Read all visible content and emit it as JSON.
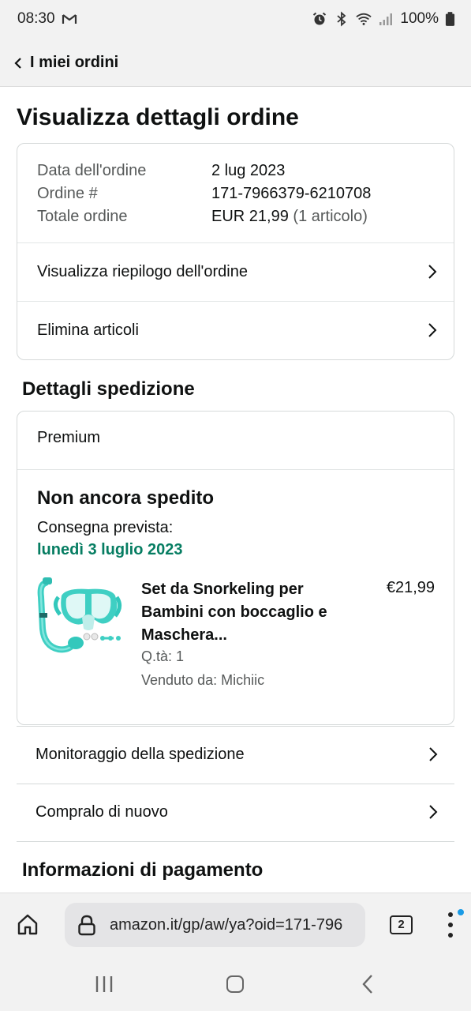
{
  "status_bar": {
    "time": "08:30",
    "battery": "100%",
    "icons": [
      "gmail-icon",
      "alarm-icon",
      "bluetooth-icon",
      "wifi-icon",
      "signal-icon",
      "battery-icon"
    ]
  },
  "header": {
    "back_label": "I miei ordini"
  },
  "page": {
    "title": "Visualizza dettagli ordine"
  },
  "order_summary": {
    "date_label": "Data dell'ordine",
    "date_value": "2 lug 2023",
    "number_label": "Ordine #",
    "number_value": "171-7966379-6210708",
    "total_label": "Totale ordine",
    "total_value": "EUR 21,99",
    "total_items": "(1 articolo)",
    "links": [
      {
        "label": "Visualizza riepilogo dell'ordine"
      },
      {
        "label": "Elimina articoli"
      }
    ]
  },
  "shipping": {
    "section_title": "Dettagli spedizione",
    "method": "Premium",
    "status": "Non ancora spedito",
    "delivery_label": "Consegna prevista:",
    "delivery_date": "lunedì 3 luglio 2023",
    "product": {
      "name": "Set da Snorkeling per Bambini con boccaglio e Maschera...",
      "price": "€21,99",
      "quantity": "Q.tà: 1",
      "seller": "Venduto da: Michiic",
      "image": "snorkel-mask-image"
    },
    "actions": [
      {
        "label": "Monitoraggio della spedizione"
      },
      {
        "label": "Compralo di nuovo"
      }
    ]
  },
  "payment": {
    "section_title": "Informazioni di pagamento"
  },
  "browser": {
    "url": "amazon.it/gp/aw/ya?oid=171-796",
    "tab_count": "2"
  },
  "colors": {
    "accent_green": "#067d62",
    "text": "#0f1111",
    "muted": "#565959",
    "border": "#d5d9d9",
    "notification_dot": "#1a9be6"
  }
}
